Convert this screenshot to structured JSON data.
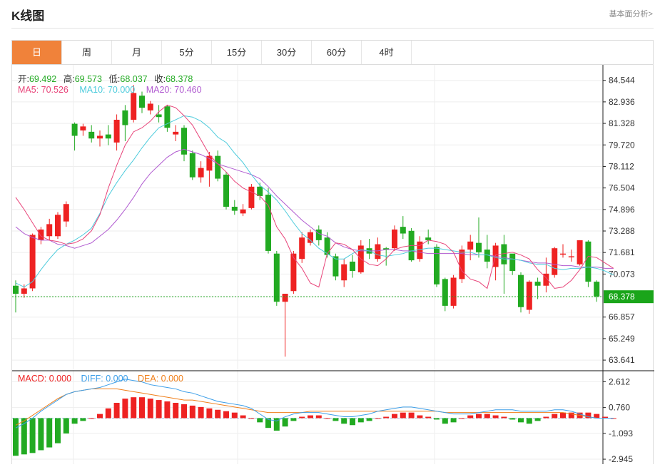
{
  "header": {
    "title": "K线图",
    "more_label": "基本面分析>"
  },
  "tabs": [
    {
      "label": "日",
      "active": true
    },
    {
      "label": "周",
      "active": false
    },
    {
      "label": "月",
      "active": false
    },
    {
      "label": "5分",
      "active": false
    },
    {
      "label": "15分",
      "active": false
    },
    {
      "label": "30分",
      "active": false
    },
    {
      "label": "60分",
      "active": false
    },
    {
      "label": "4时",
      "active": false
    }
  ],
  "ohlc_info": {
    "open_label": "开:",
    "open": "69.492",
    "high_label": "高:",
    "high": "69.573",
    "low_label": "低:",
    "low": "68.037",
    "close_label": "收:",
    "close": "68.378"
  },
  "ma_info": {
    "ma5": "MA5: 70.526",
    "ma10": "MA10: 70.000",
    "ma20": "MA20: 70.460"
  },
  "macd_info": {
    "macd": "MACD: 0.000",
    "diff": "DIFF: 0.000",
    "dea": "DEA: 0.000"
  },
  "colors": {
    "up": "#ee2222",
    "down": "#22aa22",
    "ma5": "#e8457a",
    "ma10": "#4ccbdc",
    "ma20": "#b05ad0",
    "diff": "#3c9ee8",
    "dea": "#f07f1a",
    "last_price_bg": "#1aa51a",
    "tab_active": "#f0823a"
  },
  "chart_data": {
    "type": "candlestick",
    "price_axis": {
      "ticks": [
        "84.544",
        "82.936",
        "81.328",
        "79.720",
        "78.112",
        "76.504",
        "74.896",
        "73.288",
        "71.681",
        "70.073",
        "68.378",
        "66.857",
        "65.249",
        "63.641"
      ],
      "min": 63.641,
      "max": 84.544
    },
    "last_price": "68.378",
    "macd_axis": {
      "ticks": [
        "2.612",
        "0.760",
        "-1.093",
        "-2.945"
      ]
    },
    "candles": [
      [
        69.2,
        68.6,
        69.6,
        67.2
      ],
      [
        68.6,
        69.0,
        69.3,
        68.3
      ],
      [
        69.0,
        73.0,
        73.1,
        68.8
      ],
      [
        72.6,
        73.4,
        73.6,
        72.3
      ],
      [
        72.9,
        73.8,
        74.2,
        72.6
      ],
      [
        72.9,
        74.5,
        74.7,
        72.7
      ],
      [
        74.0,
        75.3,
        75.5,
        73.6
      ],
      [
        81.3,
        80.4,
        81.4,
        79.3
      ],
      [
        80.8,
        81.1,
        81.3,
        80.4
      ],
      [
        80.7,
        80.2,
        81.2,
        79.9
      ],
      [
        80.2,
        80.4,
        80.8,
        79.6
      ],
      [
        80.5,
        80.2,
        81.2,
        79.7
      ],
      [
        79.9,
        81.6,
        82.0,
        79.3
      ],
      [
        82.3,
        81.2,
        82.7,
        80.0
      ],
      [
        81.6,
        83.6,
        84.2,
        81.4
      ],
      [
        83.4,
        82.5,
        83.7,
        82.1
      ],
      [
        82.3,
        82.8,
        83.0,
        82.0
      ],
      [
        82.0,
        81.8,
        82.7,
        81.4
      ],
      [
        82.6,
        81.0,
        82.7,
        80.7
      ],
      [
        80.5,
        80.7,
        81.2,
        80.0
      ],
      [
        81.0,
        79.0,
        81.2,
        78.5
      ],
      [
        79.1,
        77.3,
        79.3,
        77.1
      ],
      [
        77.3,
        78.0,
        78.5,
        76.9
      ],
      [
        77.8,
        78.9,
        79.2,
        76.6
      ],
      [
        78.9,
        77.2,
        79.3,
        77.0
      ],
      [
        77.5,
        75.1,
        77.7,
        74.9
      ],
      [
        75.1,
        74.8,
        75.6,
        74.5
      ],
      [
        74.6,
        74.9,
        75.3,
        74.4
      ],
      [
        75.0,
        76.6,
        76.8,
        74.9
      ],
      [
        76.6,
        75.9,
        76.9,
        75.6
      ],
      [
        76.0,
        71.8,
        76.5,
        71.6
      ],
      [
        71.6,
        68.0,
        71.8,
        67.7
      ],
      [
        68.0,
        68.6,
        68.4,
        63.9
      ],
      [
        68.8,
        71.6,
        71.8,
        68.6
      ],
      [
        71.2,
        72.8,
        73.2,
        70.9
      ],
      [
        72.4,
        73.2,
        73.4,
        72.2
      ],
      [
        73.4,
        72.6,
        73.7,
        72.2
      ],
      [
        72.8,
        71.5,
        73.2,
        71.3
      ],
      [
        71.4,
        69.9,
        71.6,
        69.6
      ],
      [
        69.6,
        70.8,
        71.2,
        69.1
      ],
      [
        71.0,
        70.3,
        71.5,
        69.8
      ],
      [
        70.2,
        72.2,
        72.6,
        70.1
      ],
      [
        72.0,
        71.6,
        72.7,
        71.2
      ],
      [
        71.2,
        72.3,
        72.8,
        71.0
      ],
      [
        72.0,
        71.9,
        72.1,
        70.7
      ],
      [
        72.0,
        73.4,
        73.7,
        71.8
      ],
      [
        73.6,
        73.1,
        74.4,
        72.7
      ],
      [
        73.3,
        71.1,
        73.5,
        71.0
      ],
      [
        71.2,
        72.5,
        72.9,
        71.0
      ],
      [
        72.8,
        72.6,
        73.4,
        72.3
      ],
      [
        72.1,
        69.3,
        72.3,
        69.1
      ],
      [
        69.7,
        67.7,
        69.8,
        67.3
      ],
      [
        67.7,
        69.8,
        70.0,
        67.5
      ],
      [
        69.7,
        71.9,
        72.2,
        69.4
      ],
      [
        71.9,
        72.5,
        73.0,
        71.1
      ],
      [
        72.4,
        71.7,
        74.3,
        71.3
      ],
      [
        71.9,
        71.0,
        73.0,
        70.5
      ],
      [
        70.6,
        72.2,
        72.4,
        69.6
      ],
      [
        72.3,
        70.8,
        73.0,
        68.6
      ],
      [
        71.6,
        70.3,
        71.5,
        70.0
      ],
      [
        70.0,
        67.6,
        70.2,
        67.2
      ],
      [
        67.4,
        69.5,
        69.6,
        67.1
      ],
      [
        69.5,
        69.2,
        69.8,
        68.2
      ],
      [
        69.2,
        70.1,
        71.3,
        68.7
      ],
      [
        70.0,
        72.0,
        72.1,
        69.8
      ],
      [
        71.6,
        71.6,
        72.3,
        71.3
      ],
      [
        71.4,
        71.4,
        71.9,
        71.0
      ],
      [
        70.8,
        72.6,
        72.6,
        70.7
      ],
      [
        72.5,
        69.5,
        72.6,
        69.1
      ],
      [
        69.5,
        68.4,
        69.6,
        68.0
      ]
    ],
    "ma5": [
      75.8,
      74.9,
      73.9,
      72.9,
      72.6,
      72.5,
      72.3,
      72.4,
      72.7,
      73.3,
      74.5,
      76.5,
      78.2,
      79.7,
      80.7,
      81.0,
      81.5,
      82.2,
      82.7,
      82.5,
      81.9,
      81.2,
      80.1,
      79.0,
      78.3,
      77.7,
      77.0,
      76.5,
      76.2,
      75.9,
      75.2,
      73.6,
      72.7,
      71.3,
      70.5,
      69.4,
      69.1,
      71.6,
      72.4,
      72.3,
      71.9,
      71.2,
      70.8,
      70.7,
      71.2,
      71.9,
      72.1,
      72.2,
      72.2,
      72.6,
      72.5,
      72.3,
      71.7,
      70.3,
      69.7,
      69.5,
      69.0,
      71.5,
      71.6,
      71.7,
      71.5,
      71.2,
      70.4,
      69.8,
      69.0,
      69.1,
      69.6,
      70.4,
      71.4,
      71.3,
      70.9,
      70.5
    ],
    "ma10": [
      69.4,
      69.1,
      69.5,
      70.4,
      71.2,
      71.9,
      72.3,
      72.6,
      73.0,
      73.5,
      74.6,
      75.9,
      76.9,
      77.8,
      78.6,
      79.5,
      80.3,
      81.0,
      81.3,
      81.6,
      81.9,
      81.8,
      81.5,
      81.0,
      80.3,
      79.9,
      79.1,
      78.4,
      77.5,
      76.7,
      76.2,
      75.6,
      74.8,
      73.9,
      73.1,
      72.6,
      72.0,
      71.6,
      71.2,
      71.2,
      71.6,
      71.9,
      71.8,
      71.5,
      71.4,
      71.5,
      71.6,
      71.8,
      71.9,
      72.0,
      72.0,
      71.9,
      71.8,
      71.7,
      71.7,
      71.5,
      71.5,
      71.3,
      71.2,
      71.2,
      71.1,
      70.9,
      70.8,
      70.8,
      70.5,
      70.4,
      70.5,
      70.5,
      70.6,
      70.5,
      70.3,
      70.0
    ],
    "ma20": [
      73.6,
      73.1,
      72.8,
      72.6,
      72.6,
      72.3,
      72.2,
      72.0,
      72.2,
      72.4,
      72.9,
      73.4,
      74.1,
      74.9,
      75.8,
      76.8,
      77.6,
      78.2,
      78.8,
      79.2,
      79.4,
      79.2,
      79.0,
      78.7,
      78.3,
      78.1,
      77.9,
      77.7,
      77.5,
      77.2,
      76.6,
      75.9,
      75.3,
      74.7,
      74.1,
      73.6,
      73.1,
      72.9,
      72.4,
      72.1,
      71.9,
      71.8,
      71.8,
      71.8,
      71.9,
      71.9,
      71.8,
      71.8,
      71.7,
      71.6,
      71.6,
      71.6,
      71.6,
      71.6,
      71.5,
      71.5,
      71.5,
      71.4,
      71.3,
      71.2,
      71.1,
      71.0,
      70.9,
      70.9,
      70.8,
      70.7,
      70.7,
      70.6,
      70.6,
      70.6,
      70.5,
      70.5
    ],
    "macd_hist": [
      -2.7,
      -2.6,
      -2.5,
      -2.3,
      -2.1,
      -1.8,
      -1.1,
      -0.4,
      -0.2,
      0.0,
      0.3,
      0.7,
      1.1,
      1.4,
      1.5,
      1.5,
      1.4,
      1.3,
      1.2,
      1.1,
      1.0,
      0.9,
      0.8,
      0.7,
      0.6,
      0.5,
      0.4,
      0.2,
      0.0,
      -0.3,
      -0.7,
      -0.9,
      -0.6,
      -0.2,
      0.1,
      0.2,
      0.2,
      0.0,
      -0.2,
      -0.4,
      -0.5,
      -0.3,
      -0.2,
      0.0,
      0.1,
      0.3,
      0.4,
      0.4,
      0.2,
      0.1,
      -0.1,
      -0.4,
      -0.3,
      0.0,
      0.2,
      0.3,
      0.3,
      0.2,
      0.1,
      -0.1,
      -0.3,
      -0.4,
      -0.2,
      0.1,
      0.3,
      0.4,
      0.4,
      0.4,
      0.4,
      0.3,
      0.1,
      0.0
    ],
    "diff": [
      -0.7,
      -0.4,
      0.0,
      0.5,
      0.9,
      1.3,
      1.7,
      1.9,
      2.0,
      2.1,
      2.2,
      2.4,
      2.6,
      2.8,
      2.7,
      2.6,
      2.4,
      2.3,
      2.2,
      2.1,
      1.9,
      1.8,
      1.6,
      1.4,
      1.2,
      1.1,
      1.0,
      0.9,
      0.7,
      0.3,
      -0.1,
      -0.2,
      0.1,
      0.3,
      0.4,
      0.4,
      0.4,
      0.3,
      0.2,
      0.1,
      0.1,
      0.2,
      0.3,
      0.5,
      0.6,
      0.7,
      0.8,
      0.8,
      0.7,
      0.6,
      0.5,
      0.4,
      0.3,
      0.3,
      0.3,
      0.4,
      0.5,
      0.6,
      0.6,
      0.6,
      0.5,
      0.5,
      0.5,
      0.5,
      0.6,
      0.6,
      0.5,
      0.3,
      0.1,
      0.0,
      0.0,
      0.0
    ],
    "dea": [
      -0.5,
      -0.2,
      0.2,
      0.6,
      1.0,
      1.4,
      1.7,
      1.9,
      2.0,
      2.1,
      2.1,
      2.1,
      2.1,
      2.0,
      1.9,
      1.8,
      1.7,
      1.6,
      1.5,
      1.4,
      1.3,
      1.3,
      1.2,
      1.1,
      1.0,
      0.9,
      0.8,
      0.7,
      0.6,
      0.5,
      0.4,
      0.4,
      0.4,
      0.4,
      0.4,
      0.5,
      0.5,
      0.5,
      0.5,
      0.5,
      0.5,
      0.5,
      0.5,
      0.5,
      0.5,
      0.5,
      0.5,
      0.5,
      0.5,
      0.5,
      0.5,
      0.4,
      0.4,
      0.4,
      0.4,
      0.4,
      0.4,
      0.4,
      0.4,
      0.4,
      0.4,
      0.4,
      0.4,
      0.4,
      0.4,
      0.4,
      0.3,
      0.2,
      0.1,
      0.0,
      0.0,
      0.0
    ]
  }
}
